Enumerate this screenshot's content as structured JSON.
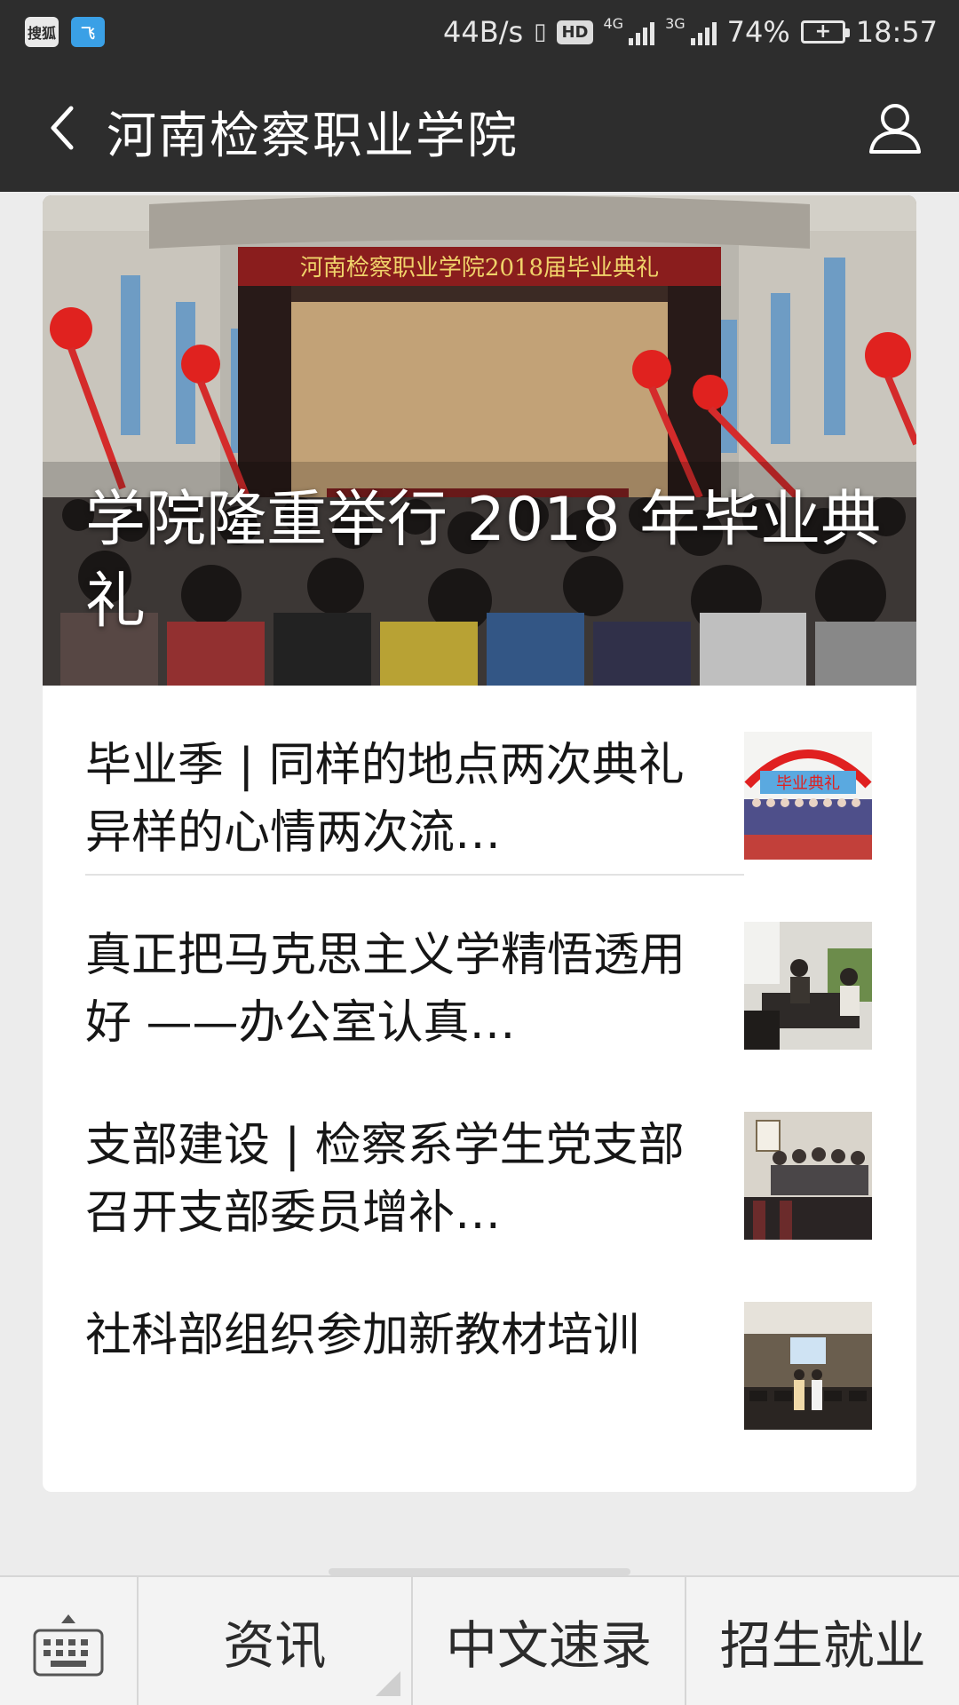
{
  "status_bar": {
    "notif_1_label": "搜狐",
    "notif_2_label": "飞",
    "net_speed": "44B/s",
    "hd_label": "HD",
    "sim1_type": "4G",
    "sim2_type": "3G",
    "battery_percent": "74%",
    "time": "18:57"
  },
  "title_bar": {
    "title": "河南检察职业学院",
    "back_icon": "chevron-left-icon",
    "profile_icon": "person-icon"
  },
  "hero": {
    "banner_text": "河南检察职业学院2018届毕业典礼",
    "title": "学院隆重举行 2018 年毕业典礼"
  },
  "articles": [
    {
      "title": "毕业季 | 同样的地点两次典礼 异样的心情两次流…"
    },
    {
      "title": "真正把马克思主义学精悟透用好 ——办公室认真…"
    },
    {
      "title": "支部建设 | 检察系学生党支部召开支部委员增补…"
    },
    {
      "title": "社科部组织参加新教材培训"
    }
  ],
  "thumb_texts": {
    "graduation_banner": "毕业典礼"
  },
  "bottom_menu": {
    "keyboard_icon": "keyboard-icon",
    "tabs": [
      "资讯",
      "中文速录",
      "招生就业"
    ]
  },
  "colors": {
    "bar_background": "#2d2d2d",
    "page_background": "#ececec",
    "card_background": "#ffffff"
  }
}
